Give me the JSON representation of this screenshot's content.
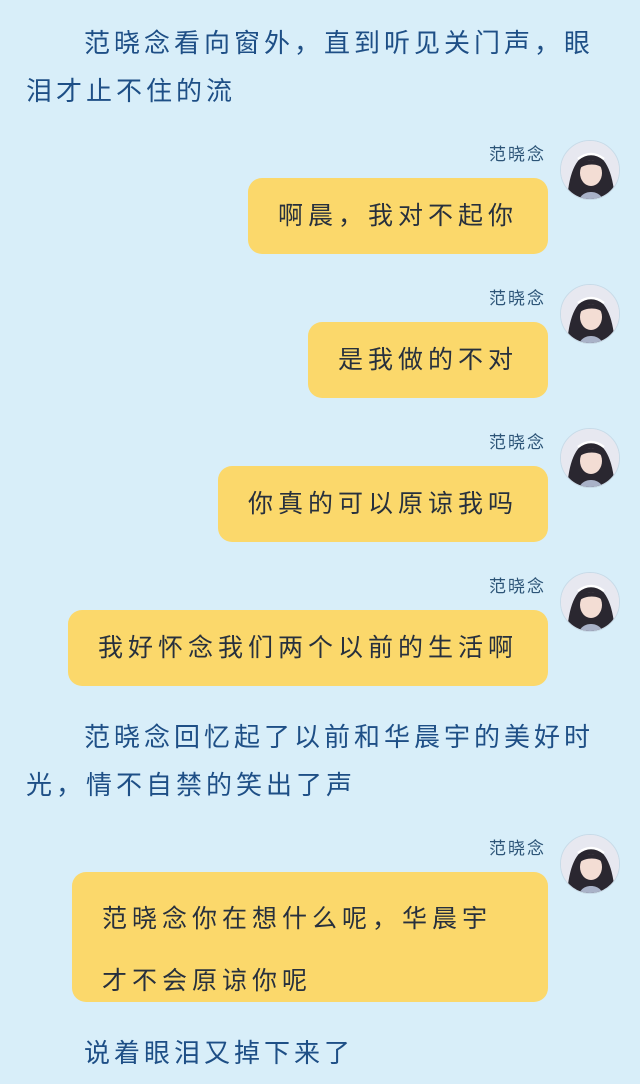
{
  "narration_1": "范晓念看向窗外，直到听见关门声，眼泪才止不住的流",
  "narration_2": "范晓念回忆起了以前和华晨宇的美好时光，情不自禁的笑出了声",
  "narration_3": "说着眼泪又掉下来了",
  "messages": [
    {
      "sender": "范晓念",
      "text": "啊晨，我对不起你"
    },
    {
      "sender": "范晓念",
      "text": "是我做的不对"
    },
    {
      "sender": "范晓念",
      "text": "你真的可以原谅我吗"
    },
    {
      "sender": "范晓念",
      "text": "我好怀念我们两个以前的生活啊"
    },
    {
      "sender": "范晓念",
      "text": "范晓念你在想什么呢，华晨宇才不会原谅你呢"
    }
  ],
  "colors": {
    "background": "#d8eef9",
    "bubble": "#fbd86b",
    "narration_text": "#1e4f86"
  },
  "icons": {
    "avatar": "avatar-girl-portrait"
  }
}
